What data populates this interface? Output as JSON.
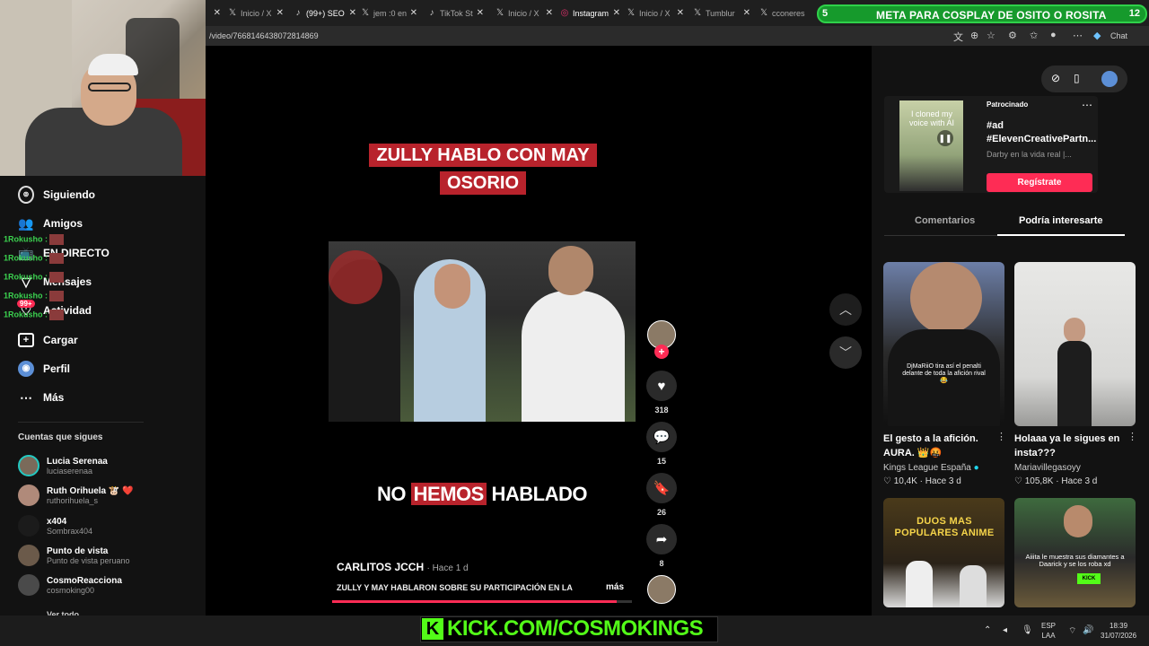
{
  "browser": {
    "tabs": [
      {
        "icon": "x-logo-icon",
        "label": "Inicio / X"
      },
      {
        "icon": "tiktok-icon",
        "label": "(99+) SEO"
      },
      {
        "icon": "x-logo-icon",
        "label": "jem :0 en"
      },
      {
        "icon": "tiktok-icon",
        "label": "TikTok St"
      },
      {
        "icon": "x-logo-icon",
        "label": "Inicio / X"
      },
      {
        "icon": "instagram-icon",
        "label": "Instagram"
      },
      {
        "icon": "x-logo-icon",
        "label": "Inicio / X"
      },
      {
        "icon": "x-logo-icon",
        "label": "Tumblur"
      },
      {
        "icon": "x-logo-icon",
        "label": "cconeres"
      }
    ],
    "url": "/video/7668146438072814869",
    "chat_label": "Chat"
  },
  "stream_goal": {
    "left_number": "5",
    "title": "META PARA COSPLAY DE OSITO O ROSITA",
    "right_number": "12"
  },
  "sidebar": {
    "nav": [
      {
        "icon": "following-icon",
        "label": "Siguiendo"
      },
      {
        "icon": "friends-icon",
        "label": "Amigos"
      },
      {
        "icon": "live-icon",
        "label": "EN DIRECTO"
      },
      {
        "icon": "messages-icon",
        "label": "Mensajes"
      },
      {
        "icon": "activity-icon",
        "label": "Actividad"
      },
      {
        "icon": "upload-icon",
        "label": "Cargar"
      },
      {
        "icon": "profile-icon",
        "label": "Perfil"
      },
      {
        "icon": "more-icon",
        "label": "Más"
      }
    ],
    "activity_badge": "99+",
    "chat_overlay": [
      "1Rokusho :",
      "1Rokusho :",
      "1Rokusho :",
      "1Rokusho :",
      "1Rokusho :"
    ],
    "following_title": "Cuentas que sigues",
    "accounts": [
      {
        "name": "Lucia Serenaa",
        "username": "luciaserenaa"
      },
      {
        "name": "Ruth Orihuela 🐮 ❤️",
        "username": "ruthorihuela_s"
      },
      {
        "name": "x404",
        "username": "Sombrax404"
      },
      {
        "name": "Punto de vista",
        "username": "Punto de vista peruano"
      },
      {
        "name": "CosmoReacciona",
        "username": "cosmoking00"
      }
    ],
    "see_all": "Ver todo"
  },
  "video": {
    "caption_top": "ZULLY HABLO CON MAY OSORIO",
    "caption_bottom_pre": "NO",
    "caption_bottom_hl": "HEMOS",
    "caption_bottom_post": "HABLADO",
    "author": "CARLITOS JCCH",
    "time": "Hace 1 d",
    "description": "ZULLY Y MAY HABLARON SOBRE SU PARTICIPACIÓN EN LA",
    "more": "más",
    "progress": 0.95,
    "likes": "318",
    "comments": "15",
    "saves": "26",
    "shares": "8"
  },
  "right_panel": {
    "ad": {
      "sponsored": "Patrocinado",
      "thumb_text": "I cloned my voice with AI",
      "tag1": "#ad",
      "tag2": "#ElevenCreativePartn...",
      "subtitle": "Darby en la vida real |...",
      "cta": "Regístrate"
    },
    "tabs": [
      "Comentarios",
      "Podría interesarte"
    ],
    "videos": [
      {
        "title": "El gesto a la afición. AURA. 👑🤬",
        "author": "Kings League España",
        "likes": "10,4K",
        "time": "Hace 3 d",
        "thumb_text": "DjMaRiiO tira así el penalti delante de toda la afición rival 😂"
      },
      {
        "title": "Holaaa ya le sigues en insta???",
        "author": "Mariavillegasoyy",
        "likes": "105,8K",
        "time": "Hace 3 d",
        "thumb_text": ""
      },
      {
        "title": "",
        "author": "",
        "likes": "",
        "time": "",
        "thumb_text": "DUOS MAS POPULARES ANIME"
      },
      {
        "title": "",
        "author": "",
        "likes": "",
        "time": "",
        "thumb_text": "Aiiita le muestra sus diamantes a Daarick y se los roba xd"
      }
    ]
  },
  "overlay": {
    "kick_letter": "K",
    "kick_text": "KICK.COM/COSMOKINGS"
  },
  "taskbar": {
    "lang1": "ESP",
    "lang2": "LAA",
    "time": "18:39",
    "date": "31/07/2026"
  },
  "colors": {
    "accent": "#fe2c55",
    "kick_green": "#53fc18",
    "goal_green": "#169a2c",
    "caption_red": "#b8232c"
  }
}
